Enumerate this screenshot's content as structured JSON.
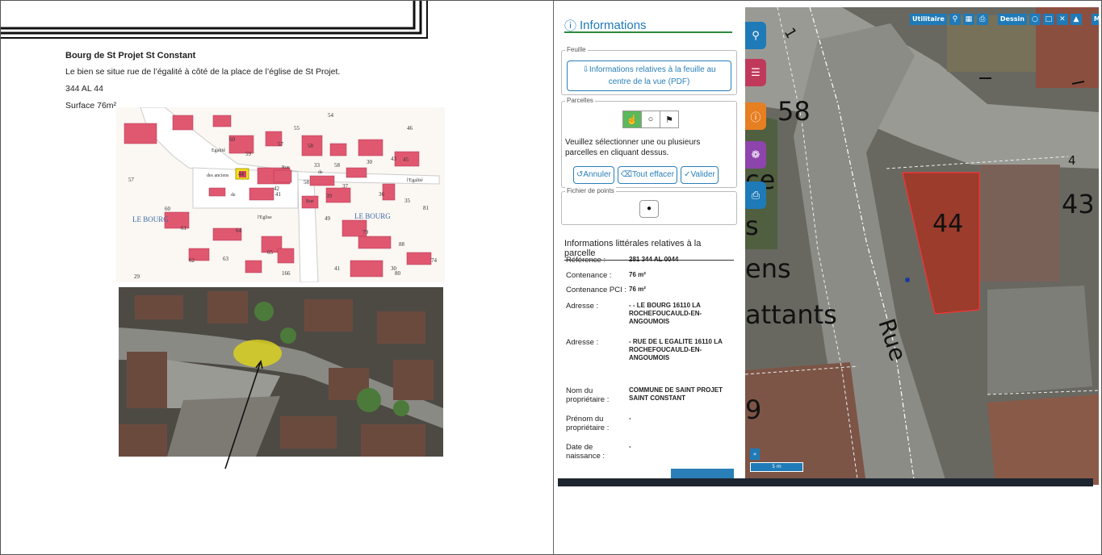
{
  "doc": {
    "title": "Bourg de St Projet St Constant",
    "line1": "Le bien se situe rue de l’égalité à côté de la place de l’église de St Projet.",
    "line2": "344 AL 44",
    "line3": "Surface 76m²"
  },
  "cadastre_map": {
    "labels": [
      "LE BOURG",
      "LE BOURG",
      "des anciens",
      "Rue",
      "de",
      "l'Eglise",
      "l'Egalité",
      "Egalité",
      "Rue",
      "de"
    ],
    "parcel_numbers": [
      "54",
      "55",
      "46",
      "60",
      "57",
      "58",
      "59",
      "45",
      "33",
      "58",
      "30",
      "43",
      "57",
      "44",
      "37",
      "41",
      "42",
      "39",
      "36",
      "35",
      "58",
      "81",
      "60",
      "61",
      "64",
      "49",
      "79",
      "62",
      "63",
      "65",
      "88",
      "74",
      "30",
      "41",
      "166",
      "80",
      "29"
    ]
  },
  "panel": {
    "title": "Informations",
    "feuille_legend": "Feuille",
    "feuille_button": "Informations relatives à la feuille au centre de la vue (PDF)",
    "parcelles_legend": "Parcelles",
    "instructions": "Veuillez sélectionner une ou plusieurs parcelles en cliquant dessus.",
    "annuler": "Annuler",
    "tout_effacer": "Tout effacer",
    "valider": "Valider",
    "fichier_legend": "Fichier de points",
    "literal_title": "Informations littérales relatives à la parcelle",
    "rows": [
      {
        "k": "Référence :",
        "v": "281 344 AL 0044"
      },
      {
        "k": "Contenance :",
        "v": "76 m²"
      },
      {
        "k": "Contenance PCI :",
        "v": "76 m²"
      },
      {
        "k": "Adresse :",
        "v": "- - LE BOURG 16110 LA ROCHEFOUCAULD-EN-ANGOUMOIS"
      },
      {
        "k": "Adresse :",
        "v": "- RUE DE L EGALITE 16110 LA ROCHEFOUCAULD-EN-ANGOUMOIS"
      },
      {
        "k": "Nom du propriétaire :",
        "v": "COMMUNE DE SAINT PROJET SAINT CONSTANT"
      },
      {
        "k": "Prénom du propriétaire :",
        "v": "-"
      },
      {
        "k": "Date de naissance :",
        "v": "-"
      }
    ]
  },
  "map": {
    "toolbar": {
      "utilitaire": "Utilitaire",
      "dessin": "Dessin",
      "mesure": "Mesure"
    },
    "labels": {
      "p58": "58",
      "p44": "44",
      "p43": "43",
      "p4": "4",
      "w1": "ce",
      "w2": "s",
      "w3": "ens",
      "w4": "attants",
      "street": "Rue",
      "w5": "9",
      "w6": "1"
    },
    "scale": "5 m",
    "expand": "»"
  },
  "colors": {
    "accent": "#1f7ab8",
    "parcel": "#c0392b",
    "green": "#5cb85c",
    "tab_search": "#1f7ab8",
    "tab_layers": "#c0395b",
    "tab_info": "#e67e22",
    "tab_palette": "#8e44ad",
    "tab_print": "#1f7ab8"
  }
}
